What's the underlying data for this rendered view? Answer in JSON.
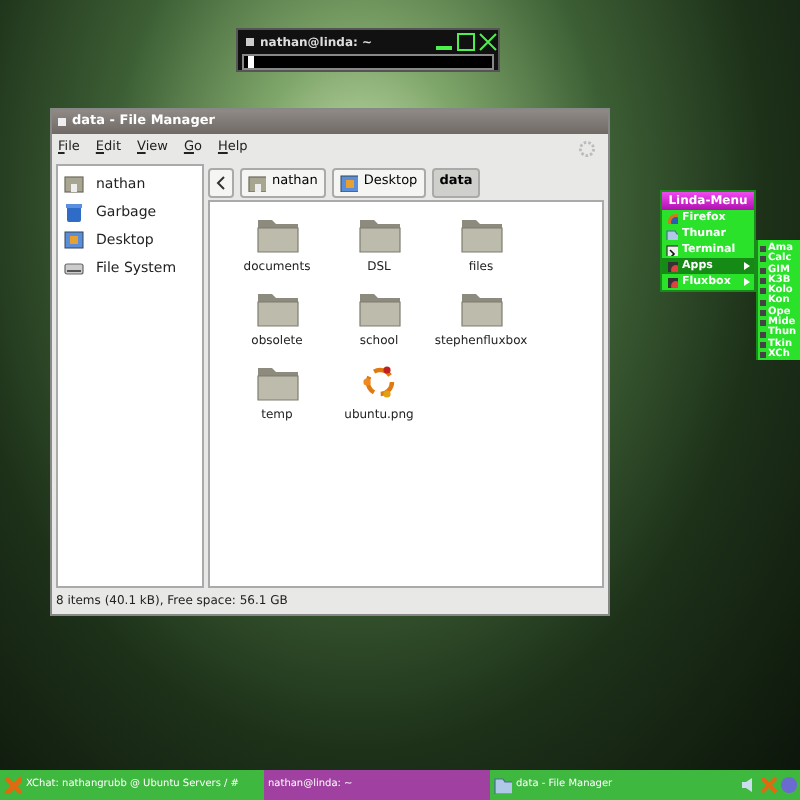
{
  "terminal": {
    "title": "nathan@linda: ~"
  },
  "file_manager": {
    "title": "data - File Manager",
    "menu": [
      "File",
      "Edit",
      "View",
      "Go",
      "Help"
    ],
    "sidebar": [
      {
        "label": "nathan",
        "kind": "home"
      },
      {
        "label": "Garbage",
        "kind": "trash"
      },
      {
        "label": "Desktop",
        "kind": "desktop"
      },
      {
        "label": "File System",
        "kind": "drive"
      }
    ],
    "path": [
      {
        "label": "nathan",
        "kind": "home",
        "selected": false
      },
      {
        "label": "Desktop",
        "kind": "desktop",
        "selected": false
      },
      {
        "label": "data",
        "kind": "none",
        "selected": true
      }
    ],
    "files": [
      {
        "name": "documents",
        "kind": "folder"
      },
      {
        "name": "DSL",
        "kind": "folder"
      },
      {
        "name": "files",
        "kind": "folder"
      },
      {
        "name": "obsolete",
        "kind": "folder"
      },
      {
        "name": "school",
        "kind": "folder"
      },
      {
        "name": "stephenfluxbox",
        "kind": "folder"
      },
      {
        "name": "temp",
        "kind": "folder"
      },
      {
        "name": "ubuntu.png",
        "kind": "image"
      }
    ],
    "status": "8 items (40.1 kB), Free space: 56.1 GB"
  },
  "linda_menu": {
    "title": "Linda-Menu",
    "items": [
      {
        "label": "Firefox",
        "kind": "globe",
        "submenu": false,
        "selected": false
      },
      {
        "label": "Thunar",
        "kind": "folder",
        "submenu": false,
        "selected": false
      },
      {
        "label": "Terminal",
        "kind": "terminal",
        "submenu": false,
        "selected": false
      },
      {
        "label": "Apps",
        "kind": "apps",
        "submenu": true,
        "selected": true
      },
      {
        "label": "Fluxbox",
        "kind": "apps",
        "submenu": true,
        "selected": false
      }
    ],
    "submenu": [
      "Ama",
      "Calc",
      "GIM",
      "K3B",
      "Kolo",
      "Kon",
      "Ope",
      "Mide",
      "Thun",
      "Tkin",
      "XCh"
    ]
  },
  "taskbar": {
    "tasks": [
      {
        "label": "XChat: nathangrubb @ Ubuntu Servers / #",
        "kind": "chat",
        "selected": false
      },
      {
        "label": "nathan@linda: ~",
        "kind": "none",
        "selected": true
      },
      {
        "label": "data - File Manager",
        "kind": "folder",
        "selected": false
      }
    ]
  }
}
